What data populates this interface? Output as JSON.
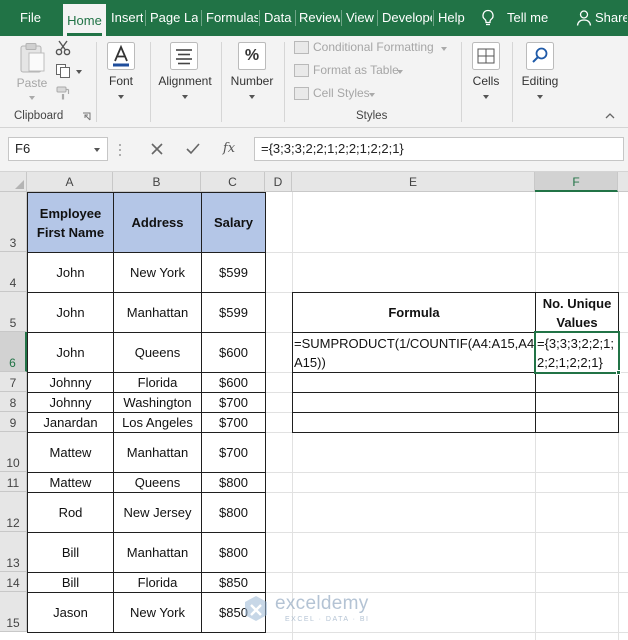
{
  "tabs": [
    "File",
    "Home",
    "Insert",
    "Page Lay",
    "Formulas",
    "Data",
    "Review",
    "View",
    "Develope",
    "Help"
  ],
  "tell_me": "Tell me",
  "share": "Share",
  "ribbon": {
    "paste": "Paste",
    "clipboard": "Clipboard",
    "font": "Font",
    "alignment": "Alignment",
    "number": "Number",
    "number_glyph": "%",
    "conditional_formatting": "Conditional Formatting",
    "format_as_table": "Format as Table",
    "cell_styles": "Cell Styles",
    "styles": "Styles",
    "cells": "Cells",
    "editing": "Editing"
  },
  "formula_bar": {
    "name_box": "F6",
    "fx": "fx",
    "formula": "={3;3;3;2;2;1;2;2;1;2;2;1}"
  },
  "columns": [
    "A",
    "B",
    "C",
    "D",
    "E",
    "F"
  ],
  "rows": [
    "3",
    "4",
    "5",
    "6",
    "7",
    "8",
    "9",
    "10",
    "11",
    "12",
    "13",
    "14",
    "15"
  ],
  "table": {
    "headers": [
      "Employee First Name",
      "Address",
      "Salary"
    ],
    "rows": [
      [
        "John",
        "New York",
        "$599"
      ],
      [
        "John",
        "Manhattan",
        "$599"
      ],
      [
        "John",
        "Queens",
        "$600"
      ],
      [
        "Johnny",
        "Florida",
        "$600"
      ],
      [
        "Johnny",
        "Washington",
        "$700"
      ],
      [
        "Janardan",
        "Los Angeles",
        "$700"
      ],
      [
        "Mattew",
        "Manhattan",
        "$700"
      ],
      [
        "Mattew",
        "Queens",
        "$800"
      ],
      [
        "Rod",
        "New Jersey",
        "$800"
      ],
      [
        "Bill",
        "Manhattan",
        "$800"
      ],
      [
        "Bill",
        "Florida",
        "$850"
      ],
      [
        "Jason",
        "New York",
        "$850"
      ]
    ]
  },
  "result_table": {
    "header_formula": "Formula",
    "header_unique": "No. Unique Values",
    "formula_line1": "=SUMPRODUCT(1/COUNTIF(A4:A15,A4:",
    "formula_line2": "A15))",
    "value_line1": "={3;3;3;2;2;1;",
    "value_line2": "2;2;1;2;2;1}"
  },
  "watermark": {
    "brand": "exceldemy",
    "tagline": "EXCEL · DATA · BI"
  },
  "colors": {
    "excel_green": "#217346",
    "header_fill": "#b4c6e7"
  }
}
